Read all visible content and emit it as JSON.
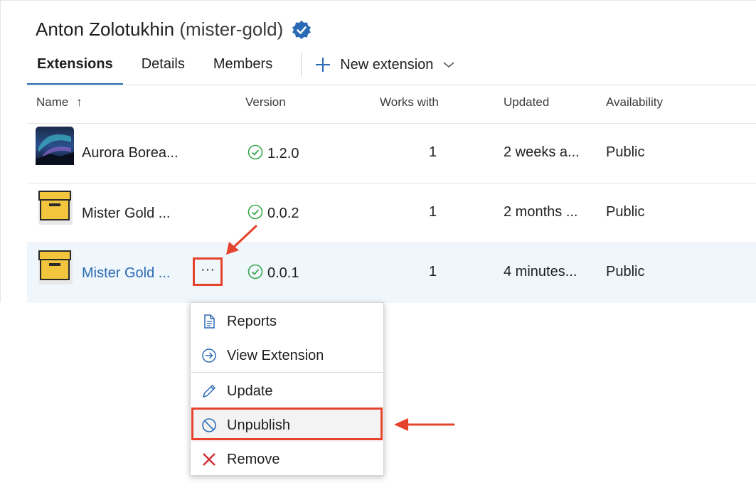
{
  "publisher": {
    "name": "Anton Zolotukhin",
    "handle": "(mister-gold)"
  },
  "tabs": [
    {
      "label": "Extensions",
      "active": true
    },
    {
      "label": "Details",
      "active": false
    },
    {
      "label": "Members",
      "active": false
    }
  ],
  "new_extension_label": "New extension",
  "columns": {
    "name": "Name",
    "version": "Version",
    "works_with": "Works with",
    "updated": "Updated",
    "availability": "Availability"
  },
  "sort_indicator": "↑",
  "rows": [
    {
      "name": "Aurora Borea...",
      "version": "1.2.0",
      "works_with": "1",
      "updated": "2 weeks a...",
      "availability": "Public",
      "icon": "aurora-thumbnail"
    },
    {
      "name": "Mister Gold ...",
      "version": "0.0.2",
      "works_with": "1",
      "updated": "2 months ...",
      "availability": "Public",
      "icon": "box-icon"
    },
    {
      "name": "Mister Gold ...",
      "version": "0.0.1",
      "works_with": "1",
      "updated": "4 minutes...",
      "availability": "Public",
      "icon": "box-icon",
      "selected": true
    }
  ],
  "more_label": "···",
  "context_menu": [
    {
      "label": "Reports",
      "icon": "report-icon"
    },
    {
      "label": "View Extension",
      "icon": "arrow-circle-icon"
    },
    {
      "label": "Update",
      "icon": "pencil-icon"
    },
    {
      "label": "Unpublish",
      "icon": "block-icon"
    },
    {
      "label": "Remove",
      "icon": "x-icon"
    }
  ],
  "colors": {
    "accent": "#2b6ab5",
    "annotation": "#e5432b",
    "selected_row": "#eff6fc",
    "check": "#3aa64a",
    "box": "#f2c53d"
  }
}
